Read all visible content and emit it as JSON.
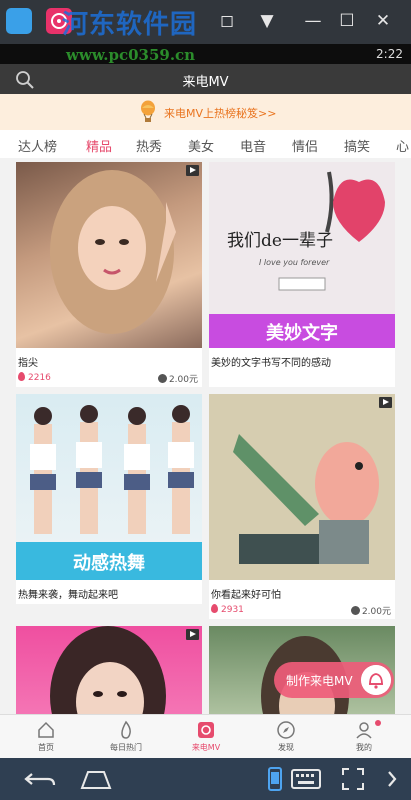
{
  "statusbar": {
    "time": "2:22"
  },
  "watermark": {
    "name": "河东软件园",
    "url": "www.pc0359.cn"
  },
  "appbar": {
    "title": "来电MV"
  },
  "banner": {
    "text": "来电MV上热榜秘笈>>"
  },
  "tabs": [
    {
      "label": "达人榜"
    },
    {
      "label": "精品",
      "active": true
    },
    {
      "label": "热秀"
    },
    {
      "label": "美女"
    },
    {
      "label": "电音"
    },
    {
      "label": "情侣"
    },
    {
      "label": "搞笑"
    },
    {
      "label": "心"
    }
  ],
  "cards": [
    {
      "title": "指尖",
      "likes": "2216",
      "price": "2.00元",
      "thumb_caption": ""
    },
    {
      "title": "美妙的文字书写不同的感动",
      "likes": "",
      "price": "",
      "thumb_caption": "美妙文字",
      "thumb_text_1": "我们de一辈子",
      "thumb_text_2": "I love you forever"
    },
    {
      "title": "热舞来袭，舞动起来吧",
      "likes": "",
      "price": "",
      "thumb_caption": "动感热舞"
    },
    {
      "title": "你看起来好可怕",
      "likes": "2931",
      "price": "2.00元",
      "thumb_caption": ""
    },
    {
      "title": "",
      "likes": "",
      "price": "",
      "thumb_caption": ""
    },
    {
      "title": "",
      "likes": "",
      "price": "",
      "thumb_caption": ""
    }
  ],
  "fab": {
    "label": "制作来电MV"
  },
  "bottomnav": [
    {
      "label": "首页",
      "icon": "home-icon"
    },
    {
      "label": "每日热门",
      "icon": "flame-icon"
    },
    {
      "label": "来电MV",
      "icon": "mv-icon",
      "active": true
    },
    {
      "label": "发现",
      "icon": "compass-icon"
    },
    {
      "label": "我的",
      "icon": "user-icon"
    }
  ],
  "colors": {
    "accent": "#e64b6d",
    "banner_text": "#e9741f",
    "header": "#3a3a3a"
  }
}
